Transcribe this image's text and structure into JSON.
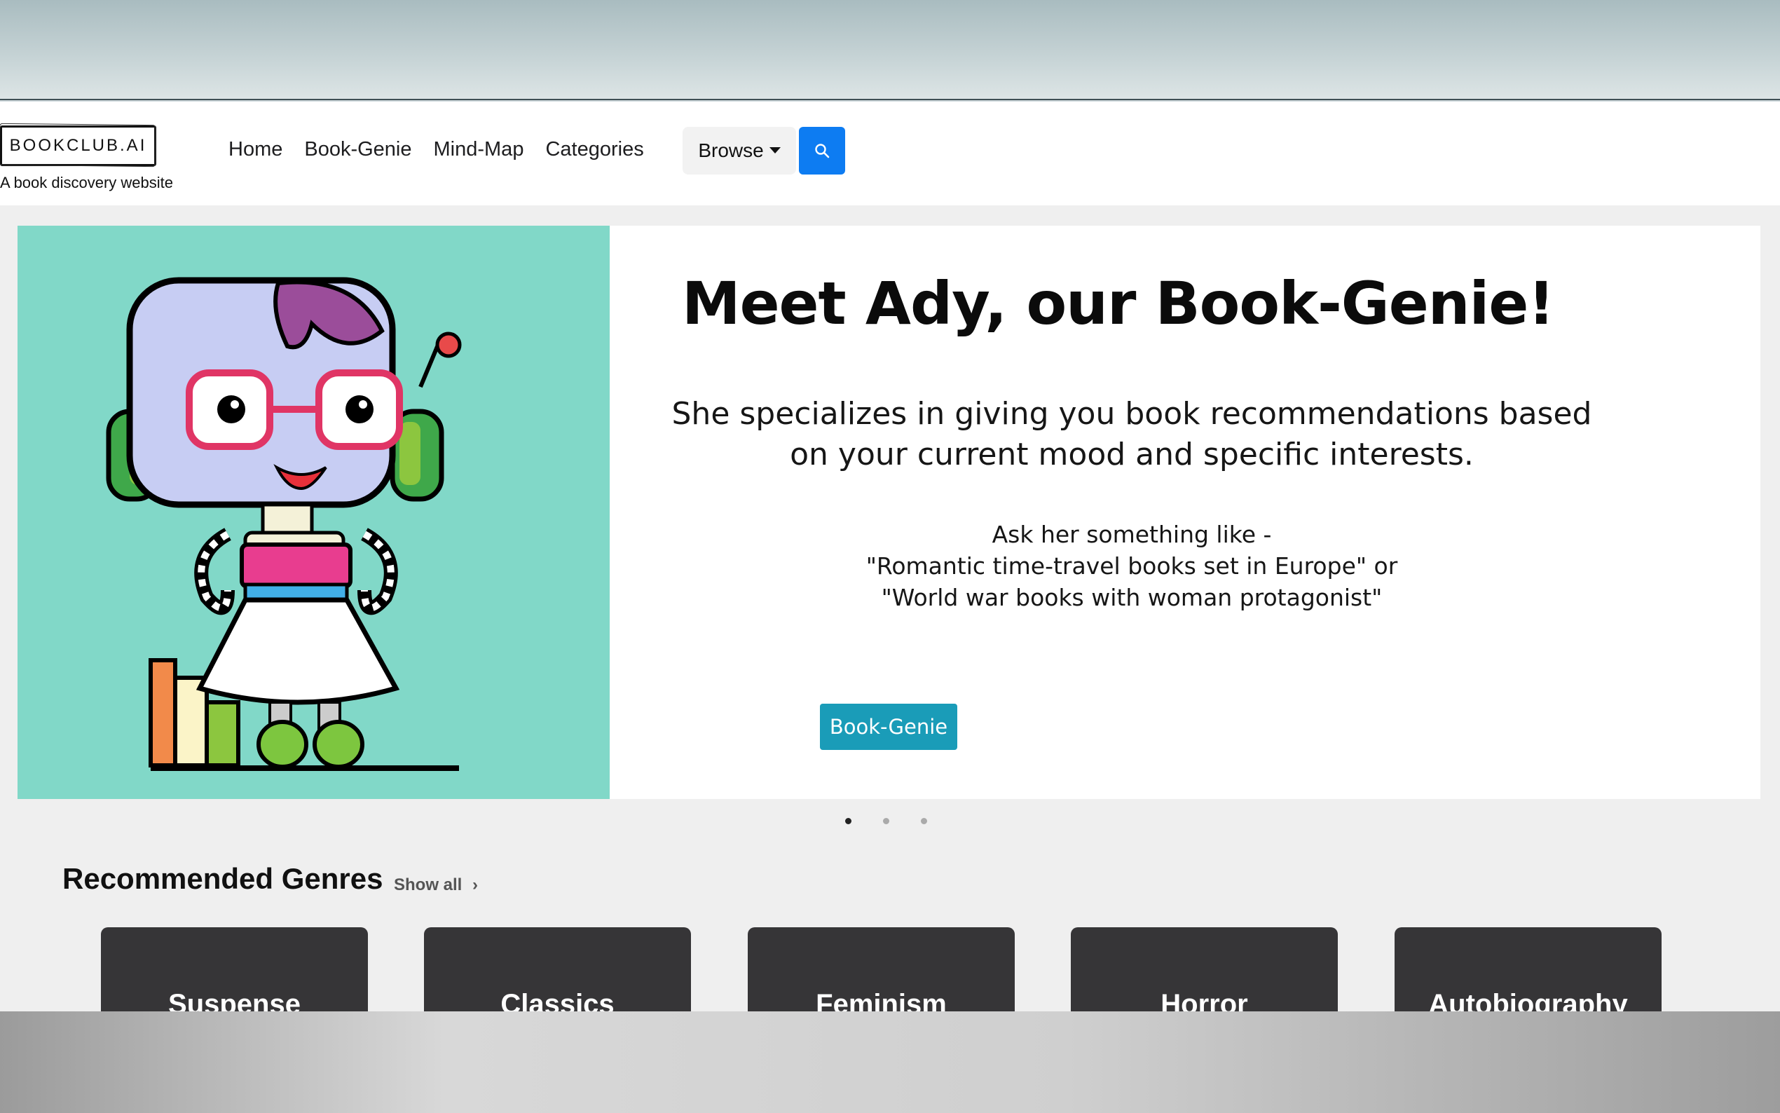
{
  "brand": {
    "logo": "BOOKCLUB.AI",
    "tagline": "A book discovery website"
  },
  "nav": {
    "links": [
      "Home",
      "Book-Genie",
      "Mind-Map",
      "Categories"
    ],
    "browse": "Browse"
  },
  "hero": {
    "title": "Meet Ady, our Book-Genie!",
    "desc_line1": "She specializes in giving you book recommendations based",
    "desc_line2": "on your current mood and specific interests.",
    "ask_line1": "Ask her something like -",
    "ask_line2": "\"Romantic time-travel books set in Europe\" or",
    "ask_line3": "\"World war books with woman protagonist\"",
    "button": "Book-Genie",
    "slides": 3,
    "active_slide": 1
  },
  "genres": {
    "title": "Recommended Genres",
    "show_all": "Show all",
    "items": [
      "Suspense",
      "Classics",
      "Feminism",
      "Horror",
      "Autobiography"
    ]
  },
  "colors": {
    "accent": "#0d7cf2",
    "genie_button": "#1a9cb8",
    "hero_bg": "#81d8c8",
    "card": "#363537"
  },
  "icons": {
    "search": "search-icon",
    "caret": "caret-down-icon"
  }
}
